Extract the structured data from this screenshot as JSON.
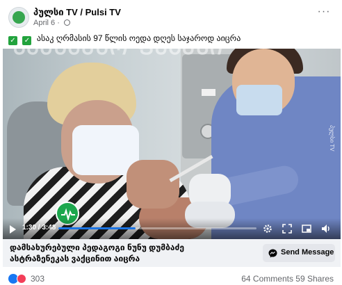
{
  "post": {
    "page_name": "პულსი TV / Pulsi TV",
    "date": "April 6",
    "more_icon": "more-horizontal-icon",
    "caption": "ასაკ ღრმასის 97 წლის ოედა დღეს საჯაროდ აიცრა"
  },
  "video": {
    "watermark": "ᲡᲐᲛᲬᲛᲔᲜᲝ ᲤᲔᲒᲔᲡᲘ",
    "side_logo": "პულსი TV",
    "current_time": "1:30",
    "total_time": "3:48",
    "time_display": "1:30 / 3:48",
    "progress": 0.39,
    "accent_color": "#1b74e4"
  },
  "link": {
    "title_line1": "დამსახურებული პედაგოგი ნუნუ დუმბაძე",
    "title_line2": "ასტრაზენეკას ვაქცინით აიცრა",
    "send_label": "Send Message"
  },
  "reactions": {
    "count": "303",
    "comments": "64 Comments",
    "shares": "59 Shares"
  }
}
